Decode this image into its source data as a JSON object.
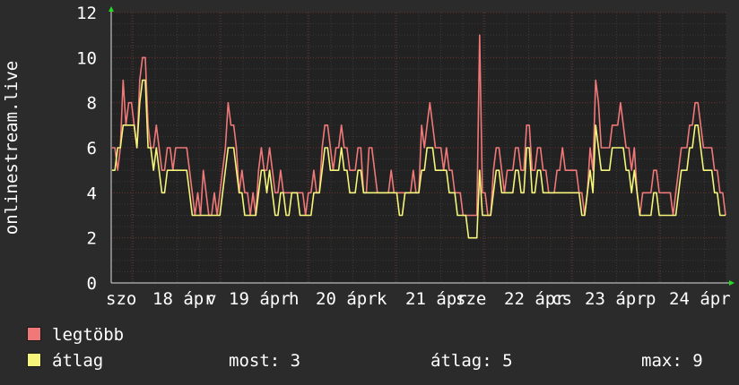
{
  "chart_data": {
    "type": "line",
    "ylabel": "onlinestream.live",
    "ylim": [
      0,
      12
    ],
    "y_ticks": [
      0,
      2,
      4,
      6,
      8,
      10,
      12
    ],
    "x_tick_labels": [
      "szo",
      "18 ápr",
      "v",
      "19 ápr",
      "h",
      "20 ápr",
      "k",
      "21 ápr",
      "sze",
      "22 ápr",
      "cs",
      "23 ápr",
      "p",
      "24 ápr"
    ],
    "grid": true,
    "series": [
      {
        "name": "legtöbb",
        "color": "#f07878",
        "values": [
          6,
          6,
          5,
          6,
          9,
          7,
          8,
          8,
          7,
          6,
          9,
          10,
          10,
          7,
          6,
          6,
          7,
          6,
          5,
          5,
          6,
          6,
          5,
          6,
          6,
          6,
          6,
          6,
          5,
          4,
          3,
          4,
          3,
          5,
          4,
          3,
          3,
          4,
          3,
          4,
          5,
          6,
          8,
          7,
          7,
          6,
          4,
          5,
          4,
          4,
          3,
          4,
          3,
          5,
          6,
          5,
          5,
          6,
          5,
          4,
          4,
          5,
          4,
          4,
          4,
          4,
          4,
          4,
          4,
          4,
          3,
          4,
          4,
          5,
          4,
          4,
          6,
          7,
          7,
          6,
          5,
          6,
          6,
          7,
          6,
          6,
          5,
          5,
          5,
          6,
          6,
          4,
          4,
          6,
          6,
          5,
          4,
          4,
          4,
          4,
          4,
          5,
          4,
          4,
          4,
          4,
          4,
          4,
          4,
          5,
          4,
          4,
          7,
          6,
          7,
          8,
          7,
          6,
          6,
          6,
          5,
          6,
          5,
          5,
          4,
          4,
          4,
          3,
          3,
          3,
          3,
          3,
          3,
          11,
          4,
          4,
          3,
          3,
          5,
          6,
          6,
          5,
          4,
          5,
          5,
          5,
          6,
          6,
          5,
          5,
          7,
          7,
          5,
          5,
          6,
          6,
          5,
          5,
          4,
          4,
          4,
          5,
          5,
          6,
          5,
          5,
          5,
          5,
          5,
          4,
          4,
          3,
          4,
          6,
          5,
          9,
          8,
          6,
          6,
          6,
          6,
          7,
          7,
          7,
          8,
          7,
          6,
          6,
          5,
          6,
          4,
          3,
          4,
          4,
          4,
          4,
          5,
          5,
          4,
          4,
          4,
          4,
          4,
          3,
          4,
          5,
          6,
          6,
          6,
          7,
          7,
          8,
          8,
          7,
          6,
          6,
          6,
          6,
          5,
          5,
          4,
          4,
          3
        ]
      },
      {
        "name": "átlag",
        "color": "#f5f57a",
        "values": [
          5,
          5,
          6,
          6,
          7,
          7,
          7,
          7,
          7,
          6,
          8,
          9,
          9,
          6,
          6,
          5,
          6,
          5,
          4,
          4,
          5,
          5,
          5,
          5,
          5,
          5,
          5,
          5,
          4,
          3,
          3,
          3,
          3,
          3,
          3,
          3,
          3,
          3,
          3,
          3,
          4,
          5,
          6,
          6,
          6,
          5,
          4,
          4,
          3,
          3,
          3,
          3,
          3,
          4,
          5,
          5,
          4,
          5,
          4,
          3,
          3,
          4,
          4,
          3,
          3,
          4,
          4,
          4,
          3,
          3,
          3,
          3,
          3,
          4,
          4,
          4,
          5,
          6,
          6,
          5,
          5,
          5,
          5,
          6,
          5,
          5,
          4,
          4,
          4,
          5,
          5,
          4,
          4,
          4,
          4,
          4,
          4,
          4,
          4,
          4,
          4,
          4,
          4,
          4,
          3,
          3,
          4,
          4,
          4,
          4,
          4,
          4,
          5,
          5,
          6,
          6,
          6,
          5,
          5,
          5,
          5,
          5,
          4,
          4,
          4,
          3,
          3,
          3,
          3,
          2,
          2,
          2,
          2,
          5,
          3,
          3,
          3,
          3,
          4,
          5,
          5,
          4,
          4,
          4,
          4,
          4,
          5,
          5,
          4,
          4,
          6,
          6,
          4,
          4,
          5,
          5,
          4,
          4,
          4,
          4,
          4,
          4,
          4,
          4,
          4,
          4,
          4,
          4,
          4,
          4,
          3,
          3,
          4,
          5,
          4,
          7,
          6,
          5,
          5,
          5,
          5,
          6,
          6,
          6,
          6,
          6,
          5,
          5,
          4,
          5,
          4,
          3,
          3,
          3,
          3,
          3,
          4,
          4,
          3,
          3,
          3,
          3,
          3,
          3,
          3,
          4,
          5,
          5,
          5,
          6,
          6,
          7,
          7,
          6,
          5,
          5,
          5,
          5,
          4,
          4,
          3,
          3,
          3
        ]
      }
    ]
  },
  "legend": [
    {
      "label": "legtöbb",
      "color": "#f07878"
    },
    {
      "label": "átlag",
      "color": "#f5f57a"
    }
  ],
  "stats": {
    "now_label": "most: 3",
    "avg_label": "átlag: 5",
    "max_label": "max: 9"
  },
  "colors": {
    "background": "#2b2b2b",
    "plot_background": "#222222",
    "grid_minor": "#3a3a3a",
    "grid_major": "#6a2f2f",
    "axis_arrow": "#22dd22"
  }
}
